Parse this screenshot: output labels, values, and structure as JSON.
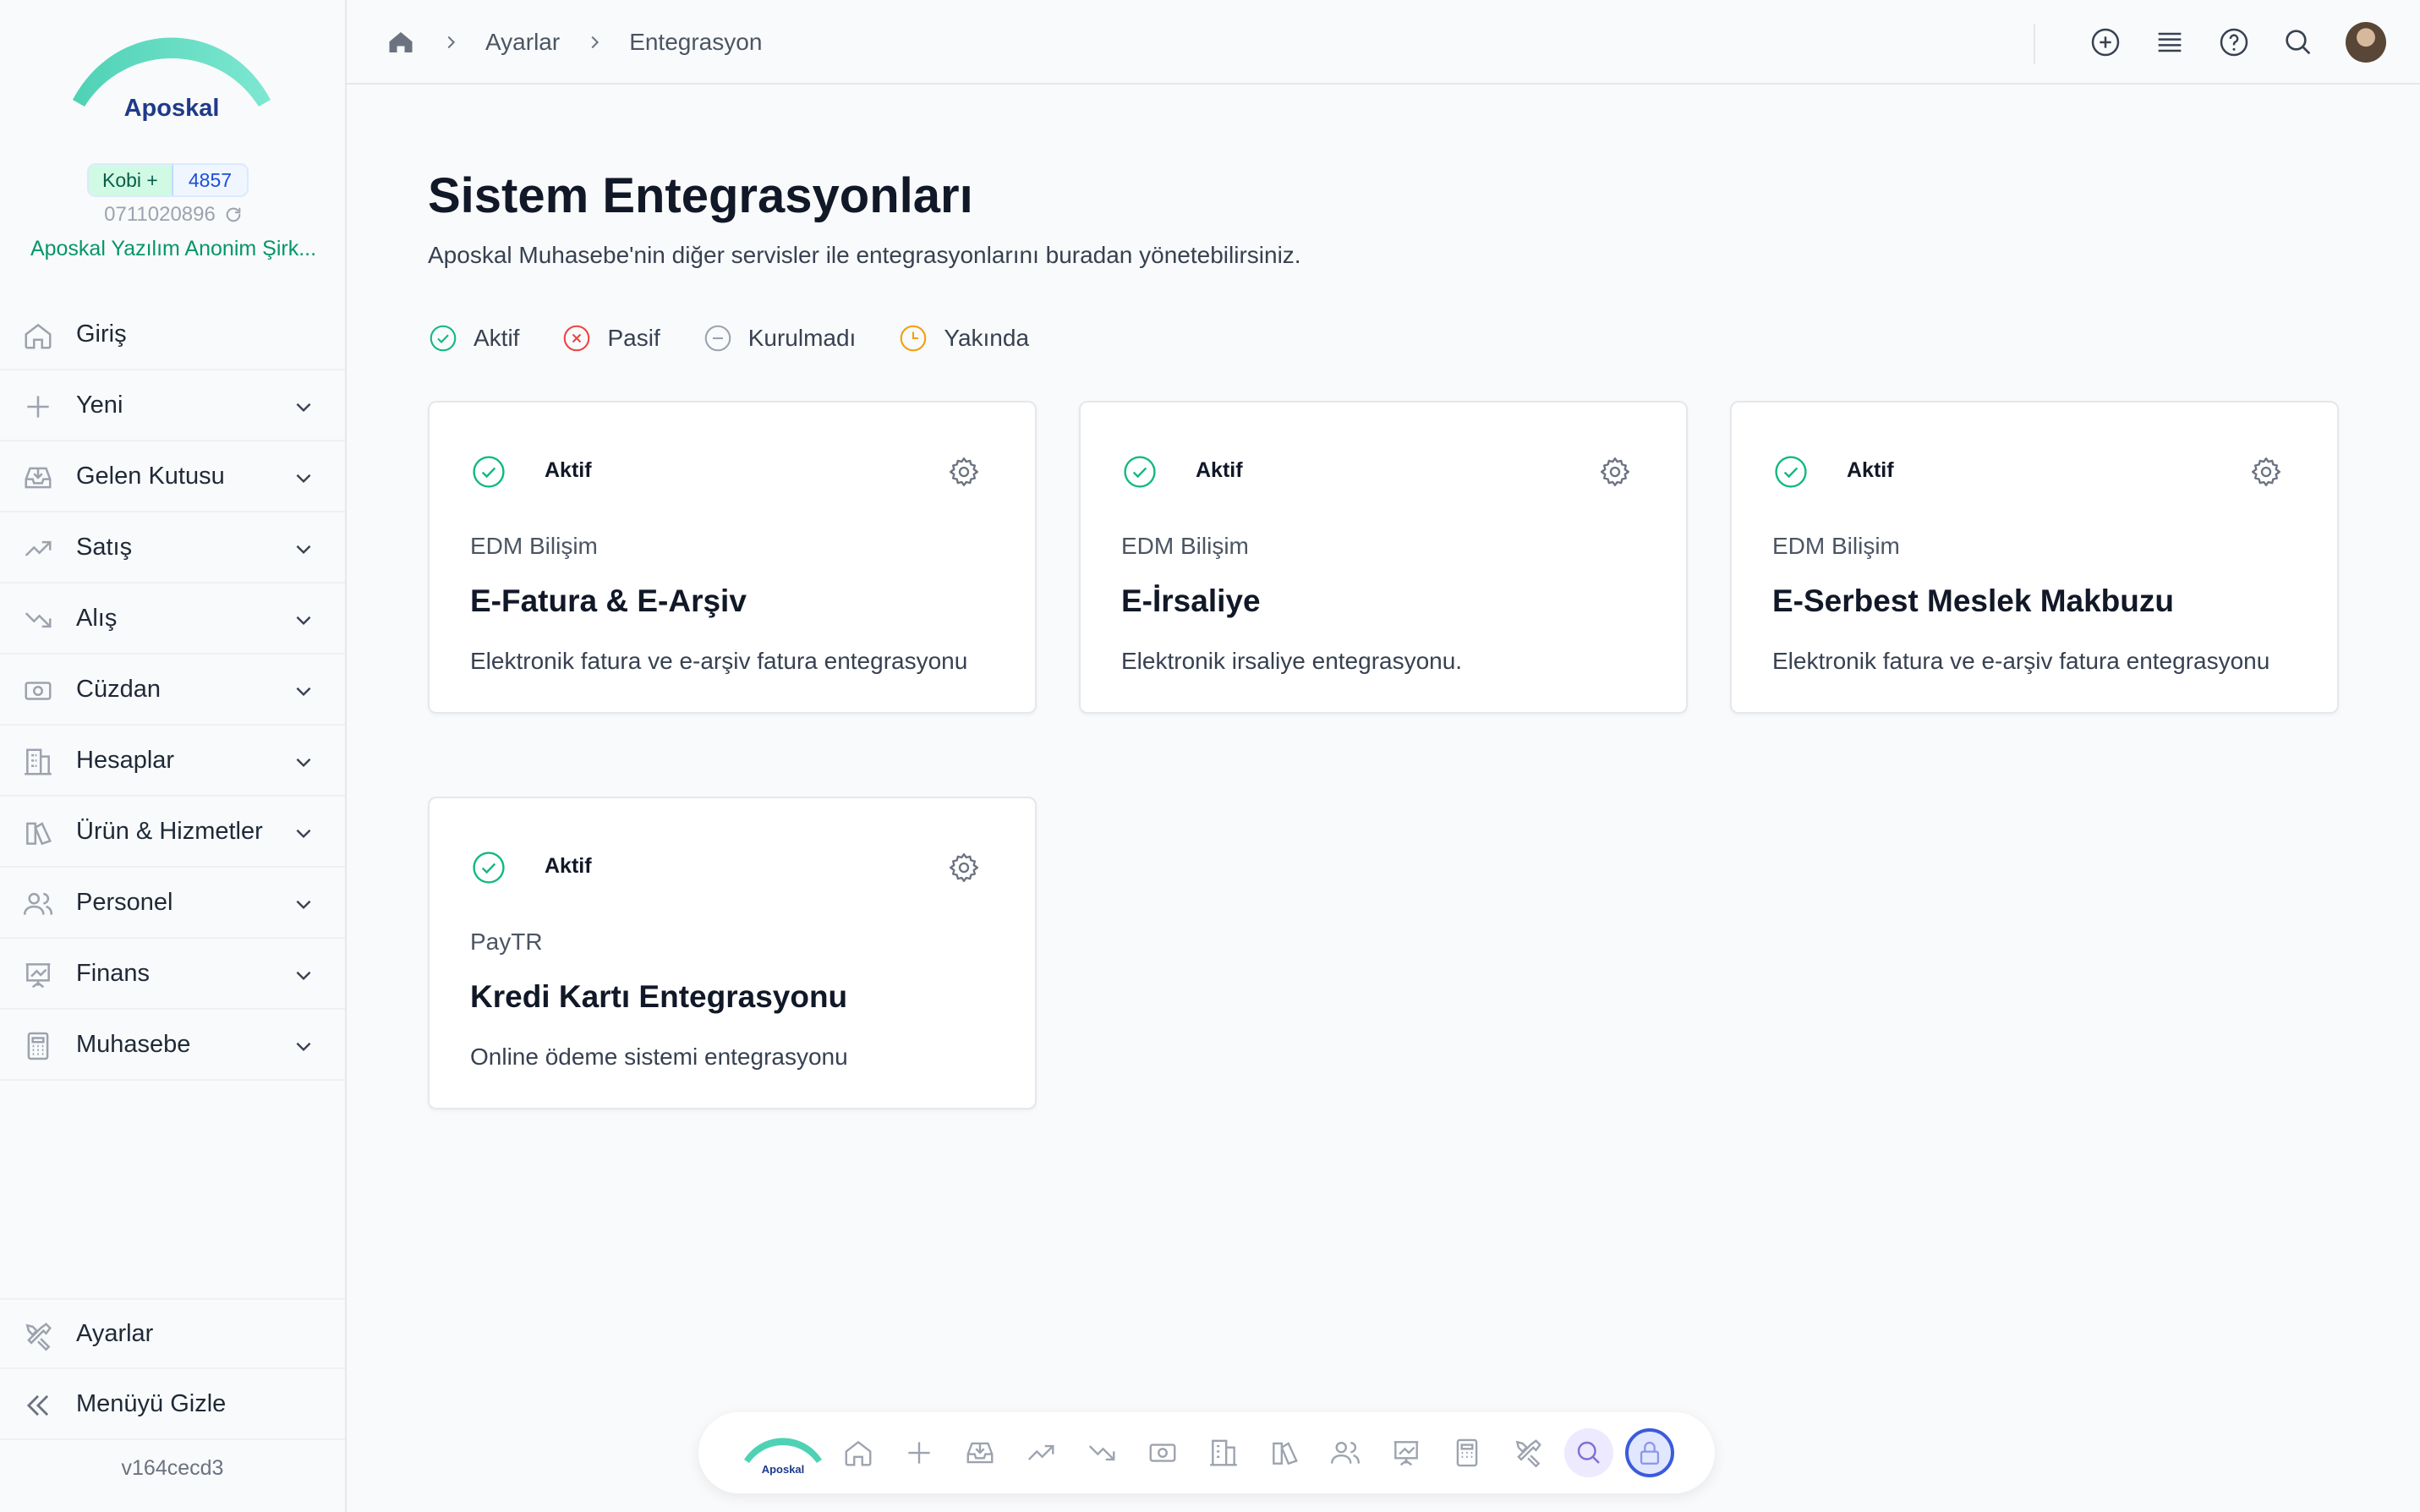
{
  "sidebar": {
    "logo_text": "Aposkal",
    "plan": "Kobi +",
    "plan_number": "4857",
    "tax_id": "0711020896",
    "company": "Aposkal Yazılım Anonim Şirk...",
    "items": [
      {
        "label": "Giriş",
        "icon": "home-icon"
      },
      {
        "label": "Yeni",
        "icon": "plus-icon"
      },
      {
        "label": "Gelen Kutusu",
        "icon": "inbox-icon"
      },
      {
        "label": "Satış",
        "icon": "trending-up-icon"
      },
      {
        "label": "Alış",
        "icon": "trending-down-icon"
      },
      {
        "label": "Cüzdan",
        "icon": "wallet-icon"
      },
      {
        "label": "Hesaplar",
        "icon": "building-icon"
      },
      {
        "label": "Ürün & Hizmetler",
        "icon": "product-icon"
      },
      {
        "label": "Personel",
        "icon": "users-icon"
      },
      {
        "label": "Finans",
        "icon": "presentation-icon"
      },
      {
        "label": "Muhasebe",
        "icon": "calculator-icon"
      }
    ],
    "settings": "Ayarlar",
    "hide_menu": "Menüyü Gizle",
    "version": "v164cecd3"
  },
  "header": {
    "breadcrumb": [
      "Ayarlar",
      "Entegrasyon"
    ]
  },
  "main": {
    "title": "Sistem Entegrasyonları",
    "subtitle": "Aposkal Muhasebe'nin diğer servisler ile entegrasyonlarını buradan yönetebilirsiniz.",
    "legend": [
      {
        "label": "Aktif",
        "color": "#10b981"
      },
      {
        "label": "Pasif",
        "color": "#ef4444"
      },
      {
        "label": "Kurulmadı",
        "color": "#9ca3af"
      },
      {
        "label": "Yakında",
        "color": "#f59e0b"
      }
    ],
    "cards": [
      {
        "status": "Aktif",
        "provider": "EDM Bilişim",
        "name": "E-Fatura & E-Arşiv",
        "description": "Elektronik fatura ve e-arşiv fatura entegrasyonu"
      },
      {
        "status": "Aktif",
        "provider": "EDM Bilişim",
        "name": "E-İrsaliye",
        "description": "Elektronik irsaliye entegrasyonu."
      },
      {
        "status": "Aktif",
        "provider": "EDM Bilişim",
        "name": "E-Serbest Meslek Makbuzu",
        "description": "Elektronik fatura ve e-arşiv fatura entegrasyonu"
      },
      {
        "status": "Aktif",
        "provider": "PayTR",
        "name": "Kredi Kartı Entegrasyonu",
        "description": "Online ödeme sistemi entegrasyonu"
      }
    ]
  },
  "dock": {
    "logo_text": "Aposkal"
  },
  "colors": {
    "brand_teal": "#5eead4",
    "brand_navy": "#1e3a8a",
    "active_green": "#10b981"
  }
}
